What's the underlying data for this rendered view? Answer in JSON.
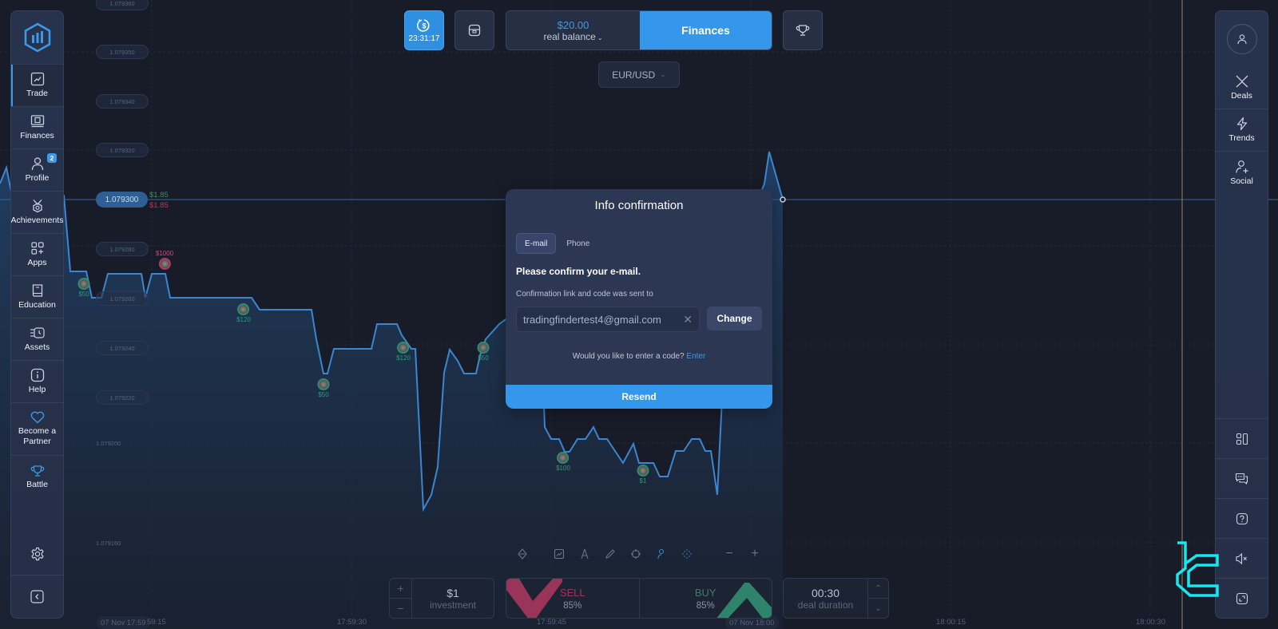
{
  "sidebar": {
    "items": [
      {
        "label": "Trade",
        "icon": "chart-line-icon",
        "active": true
      },
      {
        "label": "Finances",
        "icon": "wallet-icon"
      },
      {
        "label": "Profile",
        "icon": "user-icon",
        "badge": "2"
      },
      {
        "label": "Achievements",
        "icon": "medal-icon"
      },
      {
        "label": "Apps",
        "icon": "apps-grid-icon"
      },
      {
        "label": "Education",
        "icon": "book-icon"
      },
      {
        "label": "Assets",
        "icon": "clock-list-icon"
      },
      {
        "label": "Help",
        "icon": "info-icon"
      },
      {
        "label": "Become a Partner",
        "icon": "heart-icon"
      },
      {
        "label": "Battle",
        "icon": "trophy-icon"
      }
    ],
    "settings_icon": "gear-icon",
    "collapse_icon": "chevron-left-icon"
  },
  "topbar": {
    "timer": "23:31:17",
    "balance_amount": "$20.00",
    "balance_label": "real balance",
    "finances_label": "Finances",
    "pair": "EUR/USD"
  },
  "right_sidebar": {
    "items": [
      {
        "label": "Deals",
        "icon": "deals-icon"
      },
      {
        "label": "Trends",
        "icon": "lightning-icon"
      },
      {
        "label": "Social",
        "icon": "add-user-icon"
      }
    ],
    "bottom_icons": [
      "layout-icon",
      "chat-icon",
      "question-icon",
      "sound-mute-icon",
      "fullscreen-icon"
    ]
  },
  "chart": {
    "price_labels": [
      "1.079360",
      "1.079350",
      "1.079340",
      "1.079320",
      "1.079280",
      "1.079260",
      "1.079240",
      "1.079220",
      "1.079200",
      "1.079160"
    ],
    "current_price": "1.079300",
    "payout_up": "$1.85",
    "payout_down": "$1.85",
    "time_labels": [
      "07 Nov 17:59",
      "59:15",
      "17:59:30",
      "17:59:45",
      "07 Nov 18:00",
      "18:00:15",
      "18:00:30"
    ],
    "markers": [
      {
        "amount": "$50",
        "side": "up"
      },
      {
        "amount": "$1000",
        "side": "down"
      },
      {
        "amount": "$120",
        "side": "up"
      },
      {
        "amount": "$50",
        "side": "up"
      },
      {
        "amount": "$120",
        "side": "up"
      },
      {
        "amount": "$50",
        "side": "up"
      },
      {
        "amount": "$100",
        "side": "up"
      },
      {
        "amount": "$1",
        "side": "up"
      }
    ]
  },
  "trade": {
    "investment_value": "$1",
    "investment_label": "investment",
    "sell_label": "SELL",
    "sell_pct": "85%",
    "buy_label": "BUY",
    "buy_pct": "85%",
    "duration_value": "00:30",
    "duration_label": "deal duration"
  },
  "modal": {
    "title": "Info confirmation",
    "tabs": [
      "E-mail",
      "Phone"
    ],
    "heading": "Please confirm your e-mail.",
    "subtext": "Confirmation link and code was sent to",
    "email": "tradingfindertest4@gmail.com",
    "change_label": "Change",
    "code_question": "Would you like to enter a code?",
    "code_link": "Enter",
    "resend_label": "Resend"
  },
  "colors": {
    "accent": "#3497ec",
    "sell": "#a1365b",
    "buy": "#2f8a6e",
    "background": "#181c28"
  }
}
